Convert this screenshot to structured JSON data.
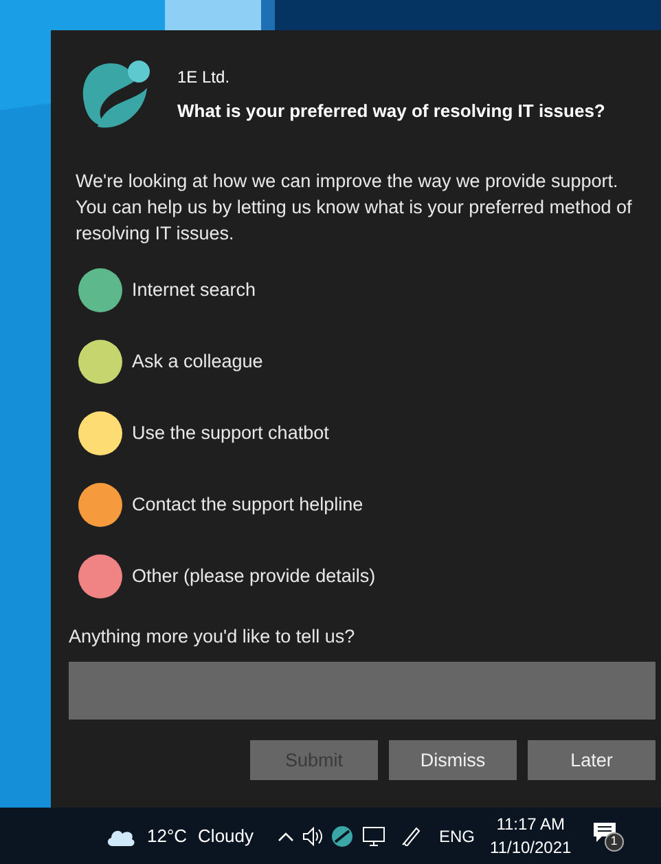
{
  "toast": {
    "app_name": "1E Ltd.",
    "title": "What is your preferred way of resolving IT issues?",
    "body": "We're looking at how we can improve the way we provide support. You can help us by letting us know what is your preferred method of resolving IT issues.",
    "options": [
      {
        "label": "Internet search",
        "color": "#5db98b",
        "selected": false
      },
      {
        "label": "Ask a colleague",
        "color": "#c6d56e",
        "selected": false
      },
      {
        "label": "Use the support chatbot",
        "color": "#fddc73",
        "selected": false
      },
      {
        "label": "Contact the support helpline",
        "color": "#f59a3d",
        "selected": false
      },
      {
        "label": "Other (please provide details)",
        "color": "#f08383",
        "selected": false
      }
    ],
    "comment_label": "Anything more you'd like to tell us?",
    "buttons": [
      {
        "label": "Submit",
        "disabled": true
      },
      {
        "label": "Dismiss",
        "disabled": false
      },
      {
        "label": "Later",
        "disabled": false
      }
    ]
  },
  "taskbar": {
    "weather_temp": "12°C",
    "weather_text": "Cloudy",
    "language": "ENG",
    "time": "11:17 AM",
    "date": "11/10/2021",
    "notification_count": "1"
  }
}
